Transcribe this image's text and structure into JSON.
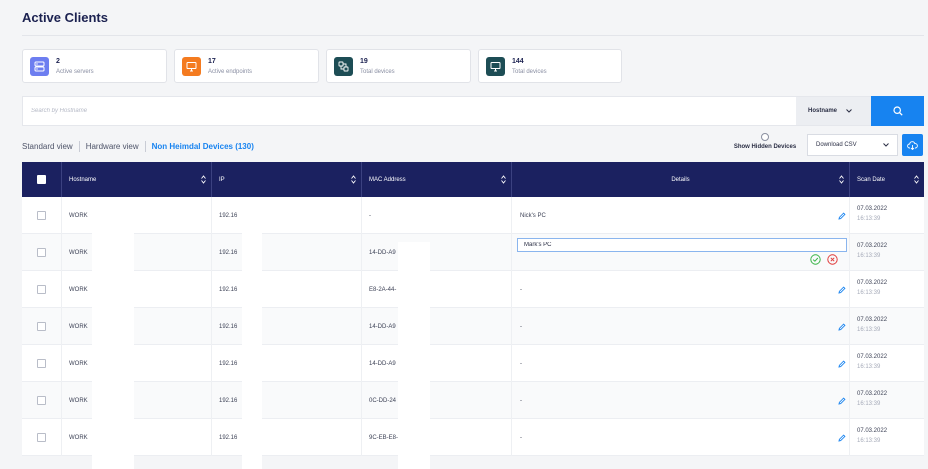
{
  "page": {
    "title": "Active Clients"
  },
  "stats": [
    {
      "value": "2",
      "label": "Active servers",
      "icon": "server-icon",
      "color": "#6d7ef0"
    },
    {
      "value": "17",
      "label": "Active endpoints",
      "icon": "monitor-icon",
      "color": "#f47b20"
    },
    {
      "value": "19",
      "label": "Total devices",
      "icon": "devices-icon",
      "color": "#1d4d55"
    },
    {
      "value": "144",
      "label": "Total devices",
      "icon": "monitor-icon",
      "color": "#1d4d55"
    }
  ],
  "search": {
    "placeholder": "Search by Hostname",
    "field": "Hostname"
  },
  "views": {
    "standard": "Standard view",
    "hardware": "Hardware view",
    "non_heimdal": "Non Heimdal Devices (130)"
  },
  "toolbar": {
    "show_hidden": "Show Hidden Devices",
    "download": "Download CSV"
  },
  "table": {
    "columns": [
      "Hostname",
      "IP",
      "MAC Address",
      "Details",
      "Scan Date"
    ],
    "rows": [
      {
        "hostname": "WORK",
        "ip": "192.16",
        "mac": "-",
        "details": "Nick's PC",
        "date": "07.03.2022",
        "time": "16:13:39"
      },
      {
        "hostname": "WORK",
        "ip": "192.16",
        "mac": "14-DD-A9",
        "details": "Mark's PC",
        "date": "07.03.2022",
        "time": "16:13:39",
        "editing": true
      },
      {
        "hostname": "WORK",
        "ip": "192.16",
        "mac": "E8-2A-44-",
        "details": "-",
        "date": "07.03.2022",
        "time": "16:13:39"
      },
      {
        "hostname": "WORK",
        "ip": "192.16",
        "mac": "14-DD-A9",
        "details": "-",
        "date": "07.03.2022",
        "time": "16:13:39"
      },
      {
        "hostname": "WORK",
        "ip": "192.16",
        "mac": "14-DD-A9",
        "details": "-",
        "date": "07.03.2022",
        "time": "16:13:39"
      },
      {
        "hostname": "WORK",
        "ip": "192.16",
        "mac": "0C-DD-24",
        "details": "-",
        "date": "07.03.2022",
        "time": "16:13:39"
      },
      {
        "hostname": "WORK",
        "ip": "192.16",
        "mac": "9C-EB-E8-",
        "details": "-",
        "date": "07.03.2022",
        "time": "16:13:39"
      }
    ]
  },
  "colors": {
    "header": "#1b2160",
    "accent": "#1783f0",
    "confirm": "#3cb54a",
    "cancel": "#e03c3c"
  }
}
